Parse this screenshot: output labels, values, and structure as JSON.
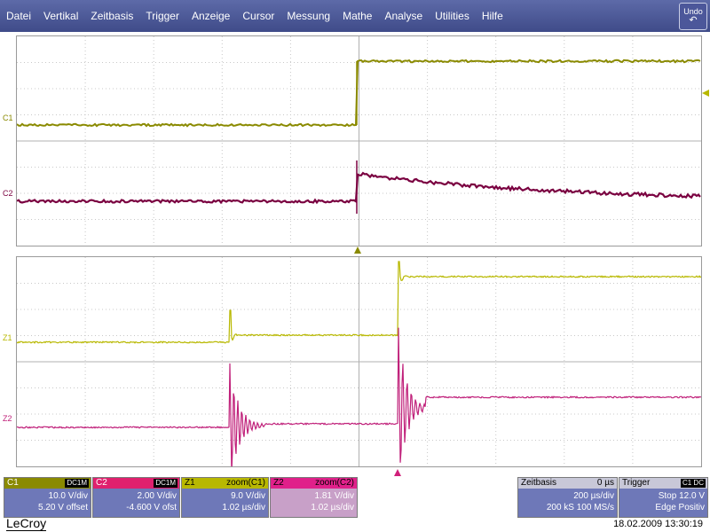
{
  "menu": {
    "items": [
      "Datei",
      "Vertikal",
      "Zeitbasis",
      "Trigger",
      "Anzeige",
      "Cursor",
      "Messung",
      "Mathe",
      "Analyse",
      "Utilities",
      "Hilfe"
    ],
    "undo_label": "Undo",
    "undo_icon": "undo-arrow-icon"
  },
  "colors": {
    "c1": "#8a8a00",
    "c2": "#7a0040",
    "z1": "#b8b800",
    "z2": "#c0207a",
    "panel": "#6e78b8"
  },
  "grid_labels": {
    "top_c1": "C1",
    "top_c2": "C2",
    "bottom_z1": "Z1",
    "bottom_z2": "Z2"
  },
  "panels": {
    "c1": {
      "name": "C1",
      "badge": "DC1M",
      "line1": "10.0 V/div",
      "line2": "5.20 V offset"
    },
    "c2": {
      "name": "C2",
      "badge": "DC1M",
      "line1": "2.00 V/div",
      "line2": "-4.600 V ofst"
    },
    "z1": {
      "name": "Z1",
      "source": "zoom(C1)",
      "line1": "9.0 V/div",
      "line2": "1.02 µs/div"
    },
    "z2": {
      "name": "Z2",
      "source": "zoom(C2)",
      "line1": "1.81 V/div",
      "line2": "1.02 µs/div"
    },
    "timebase": {
      "title": "Zeitbasis",
      "delay": "0 µs",
      "line1": "200 µs/div",
      "samples": "200 kS",
      "rate": "100 MS/s"
    },
    "trigger": {
      "title": "Trigger",
      "badge": "C1 DC",
      "mode": "Stop",
      "level": "12.0 V",
      "type": "Edge",
      "slope": "Positiv"
    }
  },
  "footer": {
    "brand": "LeCroy",
    "datetime": "18.02.2009 13:30:19"
  }
}
